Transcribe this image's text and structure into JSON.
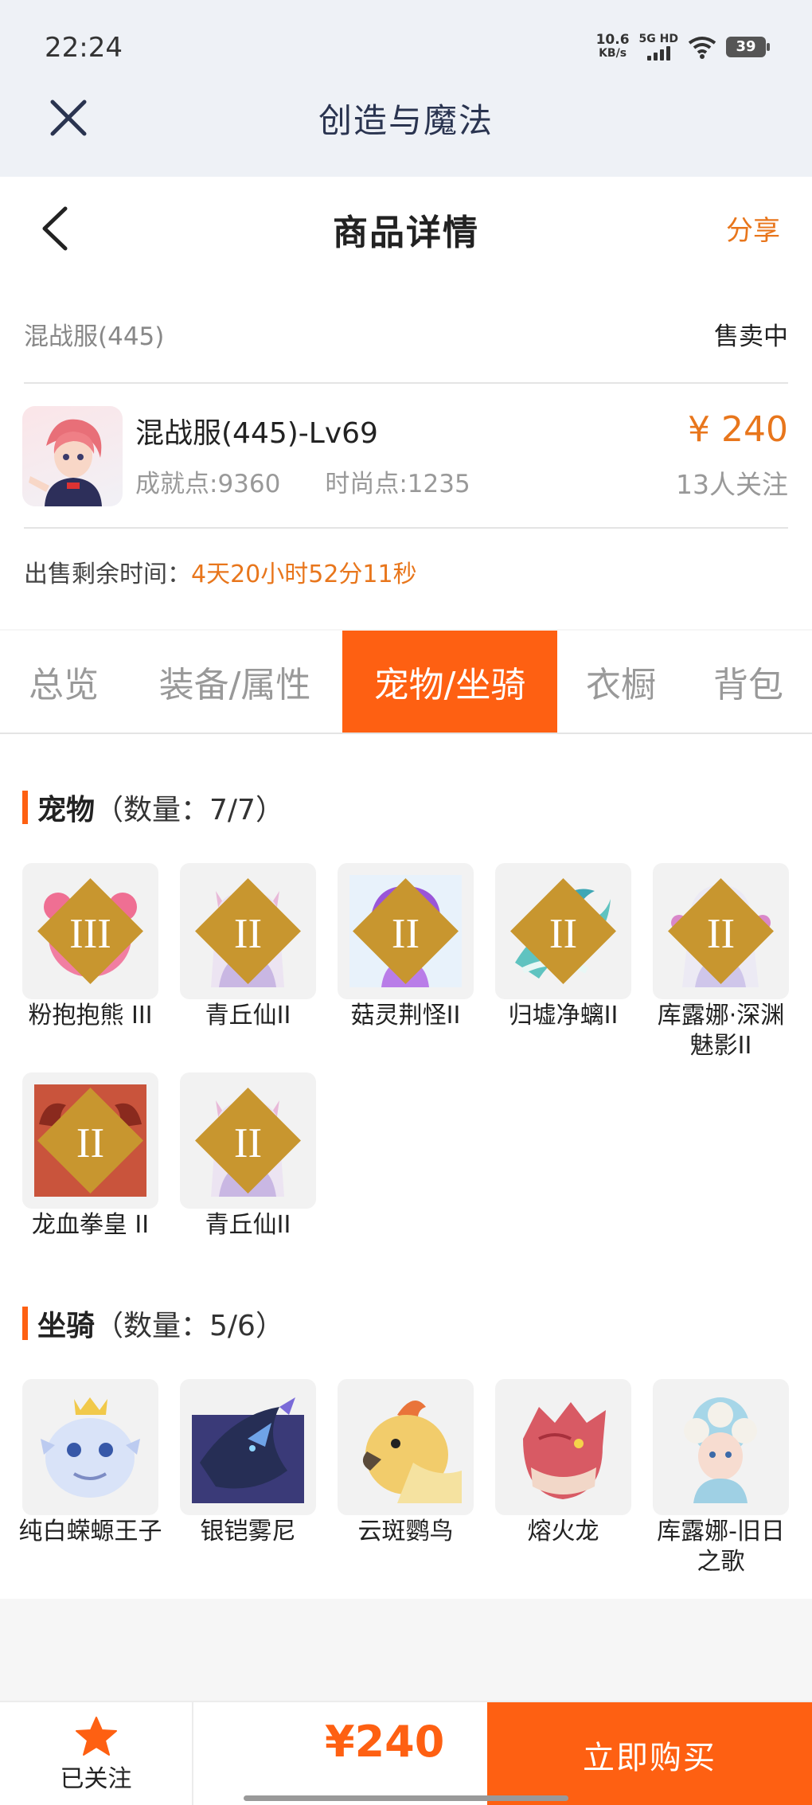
{
  "status_bar": {
    "time": "22:24",
    "net_speed_value": "10.6",
    "net_speed_unit": "KB/s",
    "net_type": "5G HD",
    "battery": "39"
  },
  "app": {
    "title": "创造与魔法"
  },
  "header": {
    "title": "商品详情",
    "share_label": "分享"
  },
  "info": {
    "server": "混战服(445)",
    "status": "售卖中",
    "character_name": "混战服(445)-Lv69",
    "achievement": "成就点:9360",
    "fashion": "时尚点:1235",
    "price": "¥ 240",
    "followers": "13人关注",
    "time_label": "出售剩余时间：",
    "time_left": "4天20小时52分11秒"
  },
  "tabs": [
    {
      "label": "总览"
    },
    {
      "label": "装备/属性"
    },
    {
      "label": "宠物/坐骑"
    },
    {
      "label": "衣橱"
    },
    {
      "label": "背包"
    }
  ],
  "active_tab": "宠物/坐骑",
  "pets": {
    "title": "宠物",
    "count": "（数量：7/7）",
    "items": [
      {
        "name": "粉抱抱熊 III"
      },
      {
        "name": "青丘仙II"
      },
      {
        "name": "菇灵荆怪II"
      },
      {
        "name": "归墟净螭II"
      },
      {
        "name": "库露娜·深渊魅影II"
      },
      {
        "name": "龙血拳皇 II"
      },
      {
        "name": "青丘仙II"
      }
    ]
  },
  "mounts": {
    "title": "坐骑",
    "count": "（数量：5/6）",
    "items": [
      {
        "name": "纯白蝾螈王子"
      },
      {
        "name": "银铠雾尼"
      },
      {
        "name": "云斑鹦鸟"
      },
      {
        "name": "熔火龙"
      },
      {
        "name": "库露娜-旧日之歌"
      }
    ]
  },
  "bottom_bar": {
    "follow_label": "已关注",
    "price": "¥240",
    "buy_label": "立即购买"
  },
  "colors": {
    "accent": "#fe6012",
    "price": "#e8761c"
  }
}
